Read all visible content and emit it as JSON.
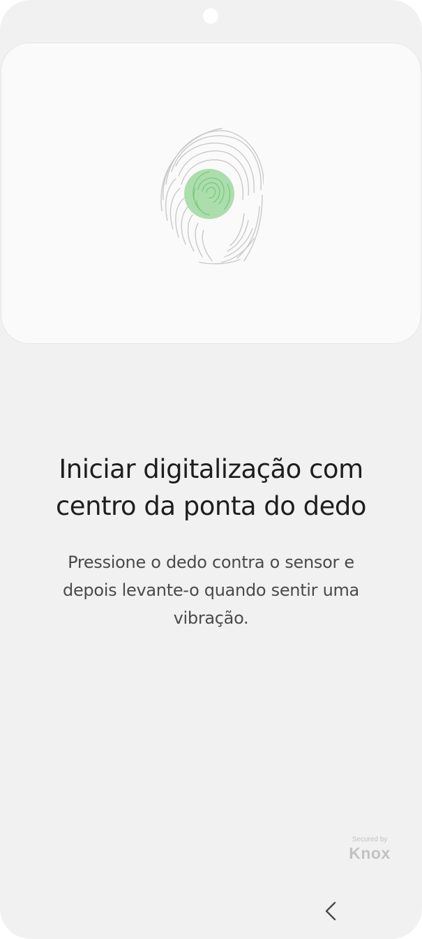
{
  "enrollment": {
    "title_line1": "Iniciar digitalização com",
    "title_line2": "centro da ponta do dedo",
    "instructions_line1": "Pressione o dedo contra o sensor e",
    "instructions_line2": "depois levante-o quando sentir uma",
    "instructions_line3": "vibração.",
    "highlight_color": "#9ed89f",
    "ridge_color": "#c9c9c9"
  },
  "footer": {
    "secured_by": "Secured by",
    "brand": "Knox"
  },
  "navigation": {
    "back_icon": "chevron-left-icon"
  }
}
